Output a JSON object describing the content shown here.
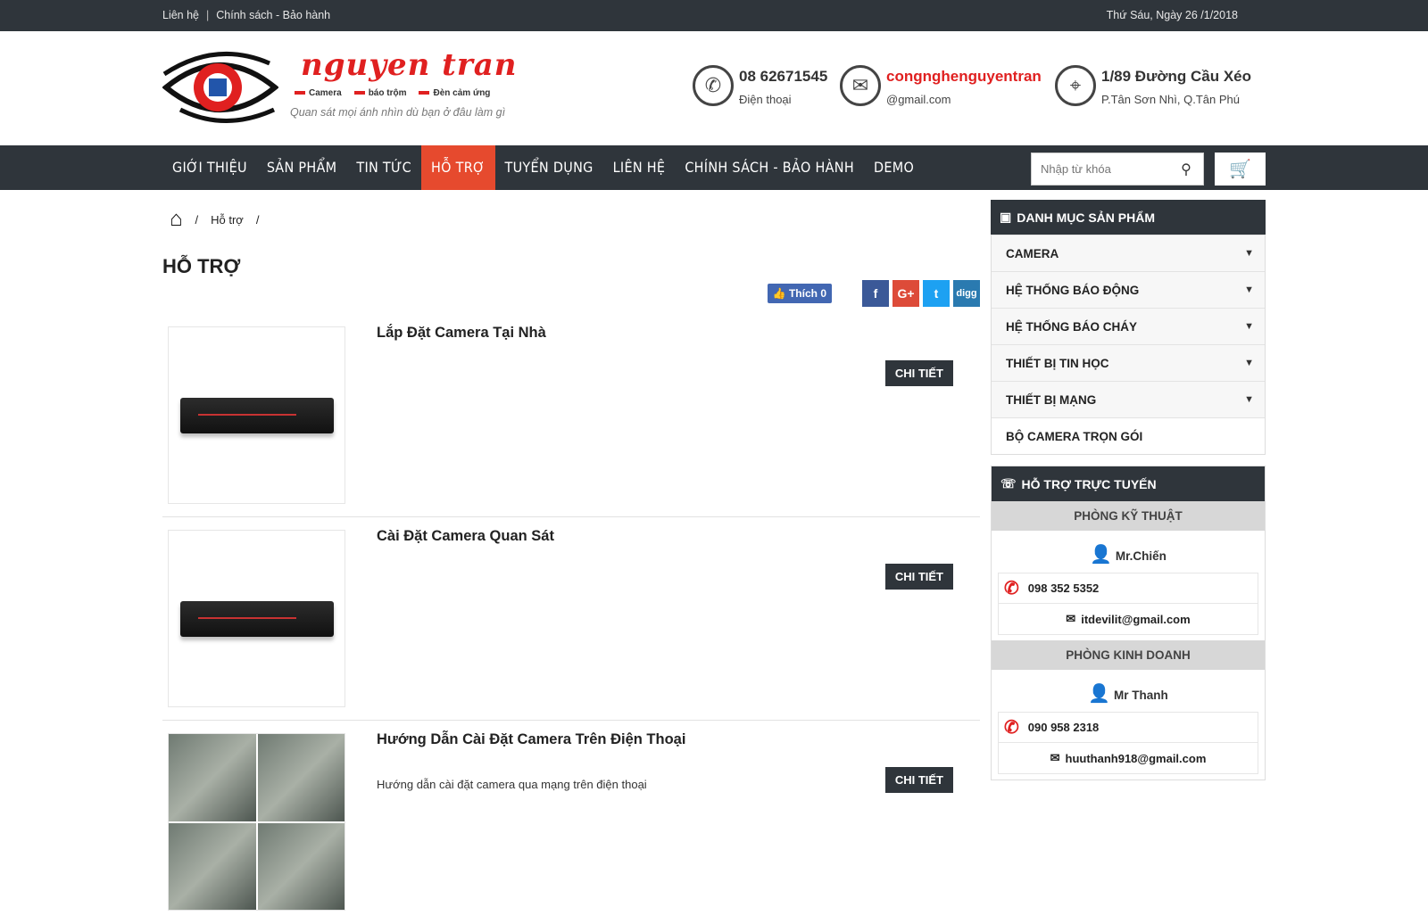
{
  "topbar": {
    "contact_link": "Liên hệ",
    "policy_link": "Chính sách - Bảo hành",
    "date": "Thứ Sáu, Ngày 26 /1/2018"
  },
  "logo": {
    "brand": "nguyen tran",
    "tags": [
      "Camera",
      "báo trộm",
      "Đèn cảm ứng"
    ],
    "slogan": "Quan sát mọi ánh nhìn dù bạn ở đâu làm gì"
  },
  "contacts": {
    "phone": {
      "value": "08 62671545",
      "label": "Điện thoại",
      "icon": "phone-icon"
    },
    "email": {
      "value": "congnghenguyentran",
      "label": "@gmail.com",
      "icon": "mail-icon"
    },
    "address": {
      "value": "1/89 Đường Cầu Xéo",
      "label": "P.Tân Sơn Nhì, Q.Tân Phú",
      "icon": "location-icon"
    }
  },
  "nav": {
    "items": [
      "GIỚI THIỆU",
      "SẢN PHẨM",
      "TIN TỨC",
      "HỖ TRỢ",
      "TUYỂN DỤNG",
      "LIÊN HỆ",
      "CHÍNH SÁCH - BẢO HÀNH",
      "DEMO"
    ],
    "active": "HỖ TRỢ",
    "search_placeholder": "Nhập từ khóa"
  },
  "breadcrumb": {
    "current": "Hỗ trợ"
  },
  "page_title": "HỖ TRỢ",
  "share": {
    "like_label": "Thích",
    "like_count": "0",
    "buttons": [
      "f",
      "G+",
      "t",
      "digg"
    ]
  },
  "posts": [
    {
      "title": "Lắp Đặt Camera Tại Nhà",
      "excerpt": "",
      "button": "CHI TIẾT"
    },
    {
      "title": "Cài Đặt Camera Quan Sát",
      "excerpt": "",
      "button": "CHI TIẾT"
    },
    {
      "title": "Hướng Dẫn Cài Đặt Camera Trên Điện Thoại",
      "excerpt": "Hướng dẫn cài đặt camera qua mạng trên điện thoại",
      "button": "CHI TIẾT"
    }
  ],
  "sidebar": {
    "categories_title": "DANH MỤC SẢN PHẨM",
    "categories": [
      {
        "label": "CAMERA",
        "has_sub": true
      },
      {
        "label": "HỆ THỐNG BÁO ĐỘNG",
        "has_sub": true
      },
      {
        "label": "HỆ THỐNG BÁO CHÁY",
        "has_sub": true
      },
      {
        "label": "THIẾT BỊ TIN HỌC",
        "has_sub": true
      },
      {
        "label": "THIẾT BỊ MẠNG",
        "has_sub": true
      },
      {
        "label": "BỘ CAMERA TRỌN GÓI",
        "has_sub": false
      }
    ],
    "support_title": "HỖ TRỢ TRỰC TUYẾN",
    "departments": [
      {
        "name": "PHÒNG KỸ THUẬT",
        "person": "Mr.Chiến",
        "phone": "098 352 5352",
        "email": "itdevilit@gmail.com"
      },
      {
        "name": "PHÒNG KINH DOANH",
        "person": "Mr Thanh",
        "phone": "090 958 2318",
        "email": "huuthanh918@gmail.com"
      }
    ]
  },
  "colors": {
    "dark": "#2f353b",
    "accent": "#e64a2e",
    "brand_red": "#e02020"
  }
}
